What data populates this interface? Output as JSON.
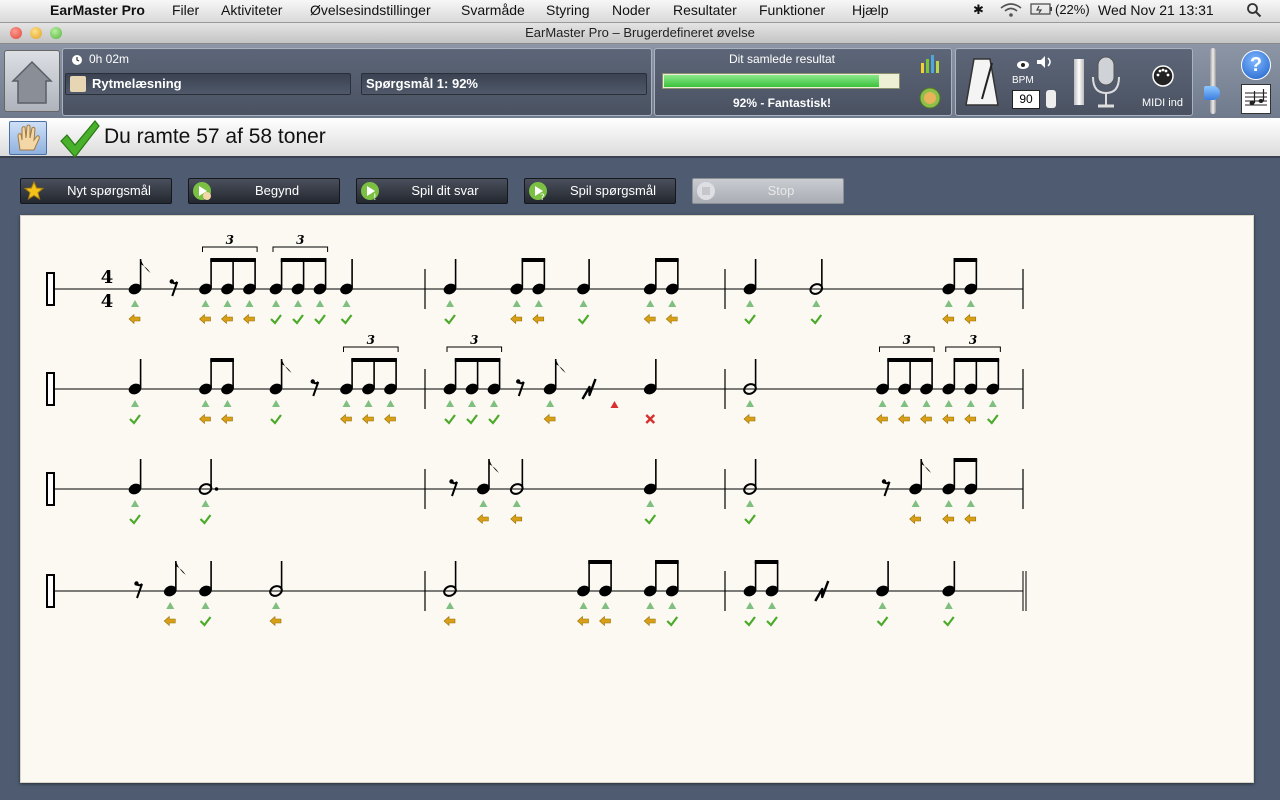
{
  "menubar": {
    "app_name": "EarMaster Pro",
    "items": [
      "Filer",
      "Aktiviteter",
      "Øvelsesindstillinger",
      "Svarmåde",
      "Styring",
      "Noder",
      "Resultater",
      "Funktioner",
      "Hjælp"
    ],
    "battery": "(22%)",
    "clock": "Wed Nov 21  13:31"
  },
  "window": {
    "title": "EarMaster Pro – Brugerdefineret øvelse"
  },
  "session": {
    "time": "0h 02m",
    "exercise": "Rytmelæsning",
    "question_score": "Spørgsmål 1: 92%",
    "overall_label": "Dit samlede resultat",
    "overall_progress": 0.92,
    "overall_text": "92% - Fantastisk!"
  },
  "controls": {
    "bpm_label": "BPM",
    "bpm_value": "90",
    "midi_label": "MIDI ind",
    "help": "?"
  },
  "status": {
    "message": "Du ramte 57 af 58 toner"
  },
  "buttons": {
    "new_question": "Nyt spørgsmål",
    "begin": "Begynd",
    "play_answer": "Spil dit svar",
    "play_question": "Spil spørgsmål",
    "stop": "Stop"
  },
  "score": {
    "time_signature": [
      "4",
      "4"
    ],
    "tuplet_number": "3",
    "rows": [
      [
        {
          "beats": [
            {
              "b": 0.5,
              "n": [
                [
                  "e",
                  1,
                  "late"
                ]
              ]
            },
            {
              "b": 0.5,
              "r": "e"
            },
            {
              "b": 1,
              "t": [
                [
                  "e",
                  1,
                  "late"
                ],
                [
                  "e",
                  1,
                  "late"
                ],
                [
                  "e",
                  1,
                  "late"
                ]
              ]
            },
            {
              "b": 1,
              "t": [
                [
                  "e",
                  1,
                  "ok"
                ],
                [
                  "e",
                  1,
                  "ok"
                ],
                [
                  "e",
                  1,
                  "ok"
                ]
              ]
            },
            {
              "b": 1,
              "n": [
                [
                  "q",
                  1,
                  "ok"
                ]
              ]
            }
          ]
        },
        {
          "beats": [
            {
              "b": 1,
              "n": [
                [
                  "q",
                  1,
                  "ok"
                ]
              ]
            },
            {
              "b": 1,
              "n": [
                [
                  "e",
                  1,
                  "late"
                ],
                [
                  "e",
                  1,
                  "late"
                ]
              ]
            },
            {
              "b": 1,
              "n": [
                [
                  "q",
                  1,
                  "ok"
                ]
              ]
            },
            {
              "b": 1,
              "n": [
                [
                  "e",
                  1,
                  "late"
                ],
                [
                  "e",
                  1,
                  "late"
                ]
              ]
            }
          ]
        },
        {
          "beats": [
            {
              "b": 1,
              "n": [
                [
                  "q",
                  1,
                  "ok"
                ]
              ]
            },
            {
              "b": 2,
              "n": [
                [
                  "h",
                  1,
                  "ok"
                ]
              ]
            },
            {
              "b": 1,
              "n": [
                [
                  "e",
                  1,
                  "late"
                ],
                [
                  "e",
                  1,
                  "late"
                ]
              ]
            }
          ]
        }
      ],
      [
        {
          "beats": [
            {
              "b": 1,
              "n": [
                [
                  "q",
                  1,
                  "ok"
                ]
              ]
            },
            {
              "b": 1,
              "n": [
                [
                  "e",
                  1,
                  "late"
                ],
                [
                  "e",
                  1,
                  "late"
                ]
              ]
            },
            {
              "b": 0.5,
              "n": [
                [
                  "e",
                  1,
                  "ok"
                ]
              ]
            },
            {
              "b": 0.5,
              "r": "e"
            },
            {
              "b": 1,
              "t": [
                [
                  "e",
                  1,
                  "late"
                ],
                [
                  "e",
                  1,
                  "late"
                ],
                [
                  "e",
                  1,
                  "late"
                ]
              ]
            }
          ]
        },
        {
          "beats": [
            {
              "b": 1,
              "t": [
                [
                  "e",
                  1,
                  "ok"
                ],
                [
                  "e",
                  1,
                  "ok"
                ],
                [
                  "e",
                  1,
                  "ok"
                ]
              ]
            },
            {
              "b": 0.5,
              "r": "e"
            },
            {
              "b": 0.5,
              "n": [
                [
                  "e",
                  1,
                  "late"
                ]
              ]
            },
            {
              "b": 1,
              "r": "q",
              "extra": true
            },
            {
              "b": 1,
              "n": [
                [
                  "q",
                  1,
                  "miss"
                ]
              ]
            }
          ]
        },
        {
          "beats": [
            {
              "b": 2,
              "n": [
                [
                  "h",
                  1,
                  "late"
                ]
              ]
            },
            {
              "b": 1,
              "t": [
                [
                  "e",
                  1,
                  "late"
                ],
                [
                  "e",
                  1,
                  "late"
                ],
                [
                  "e",
                  1,
                  "late"
                ]
              ]
            },
            {
              "b": 1,
              "t": [
                [
                  "e",
                  1,
                  "late"
                ],
                [
                  "e",
                  1,
                  "late"
                ],
                [
                  "e",
                  1,
                  "ok"
                ]
              ]
            }
          ]
        }
      ],
      [
        {
          "beats": [
            {
              "b": 1,
              "n": [
                [
                  "q",
                  1,
                  "ok"
                ]
              ]
            },
            {
              "b": 3,
              "n": [
                [
                  "dh",
                  1,
                  "ok"
                ]
              ]
            }
          ]
        },
        {
          "beats": [
            {
              "b": 0.5,
              "r": "e"
            },
            {
              "b": 0.5,
              "n": [
                [
                  "e",
                  1,
                  "late"
                ]
              ]
            },
            {
              "b": 2,
              "n": [
                [
                  "h",
                  1,
                  "late"
                ]
              ]
            },
            {
              "b": 1,
              "n": [
                [
                  "q",
                  1,
                  "ok"
                ]
              ]
            }
          ]
        },
        {
          "beats": [
            {
              "b": 2,
              "n": [
                [
                  "h",
                  1,
                  "ok"
                ]
              ]
            },
            {
              "b": 0.5,
              "r": "e"
            },
            {
              "b": 0.5,
              "n": [
                [
                  "e",
                  1,
                  "late"
                ]
              ]
            },
            {
              "b": 1,
              "n": [
                [
                  "e",
                  1,
                  "late"
                ],
                [
                  "e",
                  1,
                  "late"
                ]
              ]
            }
          ]
        }
      ],
      [
        {
          "beats": [
            {
              "b": 0.5,
              "r": "e"
            },
            {
              "b": 0.5,
              "n": [
                [
                  "e",
                  1,
                  "late"
                ]
              ]
            },
            {
              "b": 1,
              "n": [
                [
                  "q",
                  1,
                  "ok"
                ]
              ]
            },
            {
              "b": 2,
              "n": [
                [
                  "h",
                  1,
                  "late"
                ]
              ]
            }
          ]
        },
        {
          "beats": [
            {
              "b": 2,
              "n": [
                [
                  "h",
                  1,
                  "late"
                ]
              ]
            },
            {
              "b": 1,
              "n": [
                [
                  "e",
                  1,
                  "late"
                ],
                [
                  "e",
                  1,
                  "late"
                ]
              ]
            },
            {
              "b": 1,
              "n": [
                [
                  "e",
                  1,
                  "late"
                ],
                [
                  "e",
                  1,
                  "ok"
                ]
              ]
            }
          ]
        },
        {
          "beats": [
            {
              "b": 1,
              "n": [
                [
                  "e",
                  1,
                  "ok"
                ],
                [
                  "e",
                  1,
                  "ok"
                ]
              ]
            },
            {
              "b": 1,
              "r": "q"
            },
            {
              "b": 1,
              "n": [
                [
                  "q",
                  1,
                  "ok"
                ]
              ]
            },
            {
              "b": 1,
              "n": [
                [
                  "q",
                  1,
                  "ok"
                ]
              ]
            }
          ],
          "final": true
        }
      ]
    ]
  },
  "colors": {
    "ok": "#4caa2a",
    "late": "#d8a016",
    "miss": "#d83030",
    "triangle": "#7fbf7f",
    "progress": "#3bc23b"
  }
}
